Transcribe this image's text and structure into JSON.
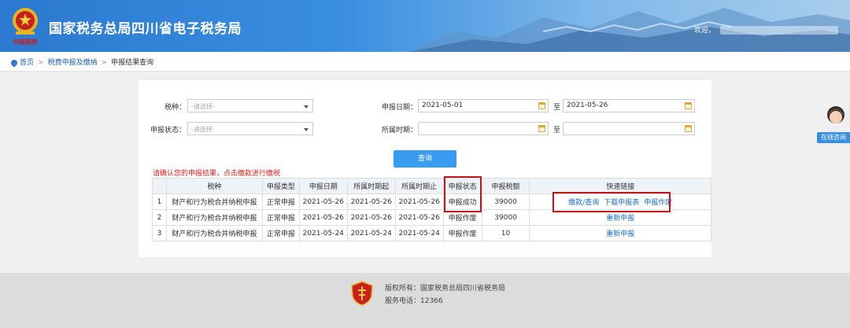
{
  "header": {
    "title": "国家税务总局四川省电子税务局",
    "welcome": "欢迎，",
    "emblem_caption": "中国税务"
  },
  "breadcrumb": {
    "home": "首页",
    "level2": "税费申报及缴纳",
    "current": "申报结果查询",
    "sep": ">"
  },
  "filters": {
    "tax_type_label": "税种：",
    "tax_type_placeholder": "-请选择-",
    "status_label": "申报状态：",
    "status_placeholder": "-请选择-",
    "decl_date_label": "申报日期：",
    "decl_date_from": "2021-05-01",
    "decl_date_to": "2021-05-26",
    "period_label": "所属时期：",
    "period_from": "",
    "period_to": "",
    "to_label": "至"
  },
  "query_button": "查询",
  "warning": "请确认您的申报结果，点击缴款进行缴税",
  "table": {
    "headers": [
      "",
      "税种",
      "申报类型",
      "申报日期",
      "所属时期起",
      "所属时期止",
      "申报状态",
      "申报税额",
      "快速链接"
    ],
    "rows": [
      {
        "no": "1",
        "tax": "财产和行为税合并纳税申报",
        "type": "正常申报",
        "date": "2021-05-26",
        "start": "2021-05-26",
        "end": "2021-05-26",
        "status": "申报成功",
        "amount": "39000",
        "links": [
          "缴款/查询",
          "下载申报表",
          "申报作废"
        ]
      },
      {
        "no": "2",
        "tax": "财产和行为税合并纳税申报",
        "type": "正常申报",
        "date": "2021-05-26",
        "start": "2021-05-26",
        "end": "2021-05-26",
        "status": "申报作废",
        "amount": "39000",
        "links": [
          "重新申报"
        ]
      },
      {
        "no": "3",
        "tax": "财产和行为税合并纳税申报",
        "type": "正常申报",
        "date": "2021-05-24",
        "start": "2021-05-24",
        "end": "2021-05-24",
        "status": "申报作废",
        "amount": "10",
        "links": [
          "重新申报"
        ]
      }
    ]
  },
  "consult": "在线咨询",
  "footer": {
    "copyright": "版权所有：国家税务总局四川省税务局",
    "hotline": "服务电话：12366"
  },
  "colors": {
    "header_blue": "#2b79d0",
    "button_blue": "#3a9cf0",
    "link_blue": "#1a6fd0",
    "warning_red": "#e02020",
    "highlight_red": "#c0151c"
  }
}
